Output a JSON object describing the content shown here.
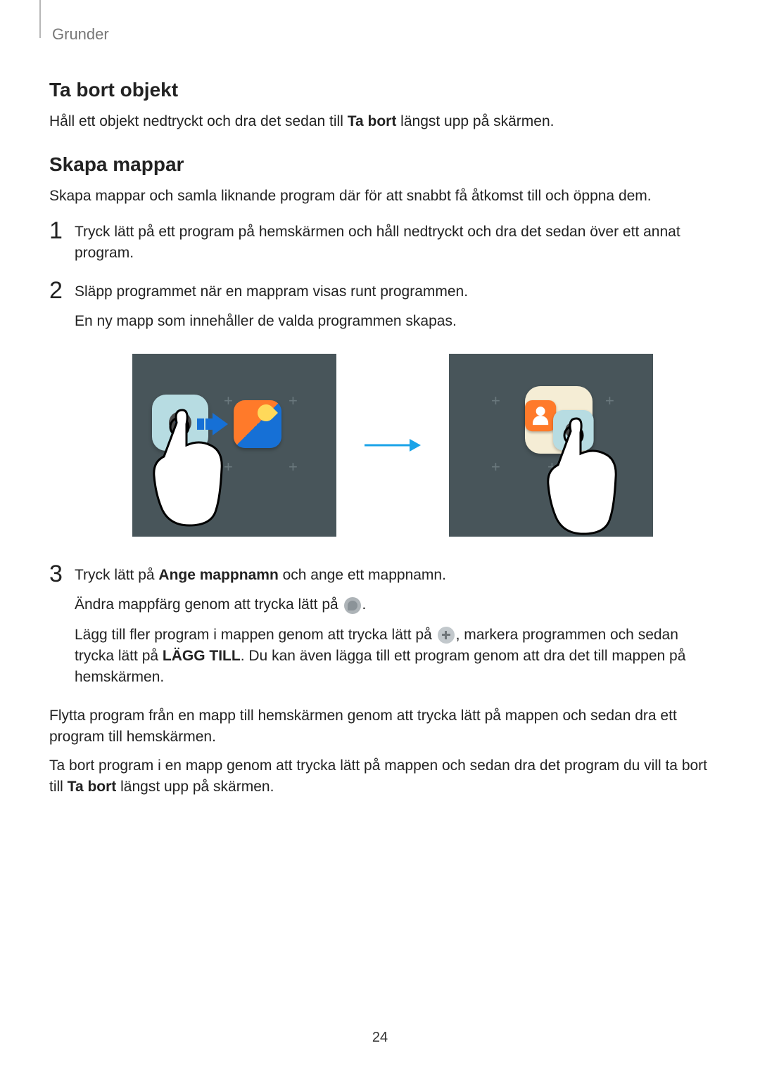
{
  "breadcrumb": "Grunder",
  "page_number": "24",
  "sections": {
    "remove": {
      "heading": "Ta bort objekt",
      "p1_pre": "Håll ett objekt nedtryckt och dra det sedan till ",
      "p1_bold": "Ta bort",
      "p1_post": " längst upp på skärmen."
    },
    "create": {
      "heading": "Skapa mappar",
      "intro": "Skapa mappar och samla liknande program där för att snabbt få åtkomst till och öppna dem.",
      "step1": "Tryck lätt på ett program på hemskärmen och håll nedtryckt och dra det sedan över ett annat program.",
      "step2a": "Släpp programmet när en mappram visas runt programmen.",
      "step2b": "En ny mapp som innehåller de valda programmen skapas.",
      "step3_a_pre": "Tryck lätt på ",
      "step3_a_bold": "Ange mappnamn",
      "step3_a_post": " och ange ett mappnamn.",
      "step3_b_pre": "Ändra mappfärg genom att trycka lätt på ",
      "step3_b_post": ".",
      "step3_c_pre": "Lägg till fler program i mappen genom att trycka lätt på ",
      "step3_c_mid": ", markera programmen och sedan trycka lätt på ",
      "step3_c_bold": "LÄGG TILL",
      "step3_c_post": ". Du kan även lägga till ett program genom att dra det till mappen på hemskärmen."
    },
    "tail": {
      "p1": "Flytta program från en mapp till hemskärmen genom att trycka lätt på mappen och sedan dra ett program till hemskärmen.",
      "p2_pre": "Ta bort program i en mapp genom att trycka lätt på mappen och sedan dra det program du vill ta bort till ",
      "p2_bold": "Ta bort",
      "p2_post": " längst upp på skärmen."
    }
  }
}
